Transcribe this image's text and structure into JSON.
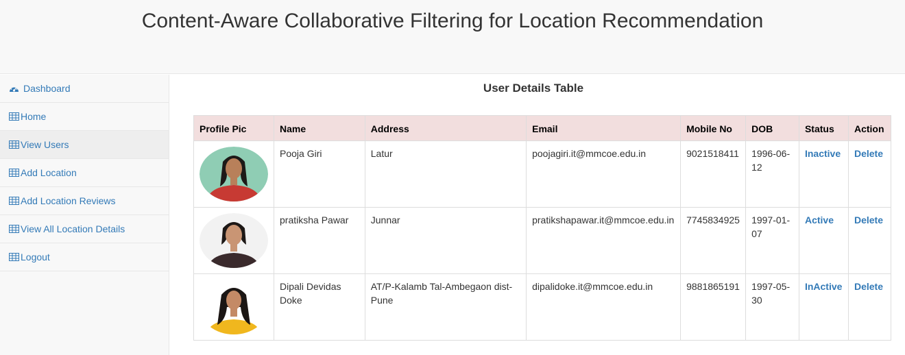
{
  "header": {
    "title": "Content-Aware Collaborative Filtering for Location Recommendation"
  },
  "sidebar": {
    "items": [
      {
        "label": "Dashboard",
        "icon": "dashboard-icon"
      },
      {
        "label": "Home",
        "icon": "table-icon"
      },
      {
        "label": "View Users",
        "icon": "table-icon"
      },
      {
        "label": "Add Location",
        "icon": "table-icon"
      },
      {
        "label": "Add Location Reviews",
        "icon": "table-icon"
      },
      {
        "label": "View All Location Details",
        "icon": "table-icon"
      },
      {
        "label": "Logout",
        "icon": "table-icon"
      }
    ],
    "active_index": 2
  },
  "main": {
    "title": "User Details Table",
    "columns": [
      "Profile Pic",
      "Name",
      "Address",
      "Email",
      "Mobile No",
      "DOB",
      "Status",
      "Action"
    ],
    "rows": [
      {
        "name": "Pooja Giri",
        "address": "Latur",
        "email": "poojagiri.it@mmcoe.edu.in",
        "mobile": "9021518411",
        "dob": "1996-06-12",
        "status": "Inactive",
        "action": "Delete"
      },
      {
        "name": "pratiksha Pawar",
        "address": "Junnar",
        "email": "pratikshapawar.it@mmcoe.edu.in",
        "mobile": "7745834925",
        "dob": "1997-01-07",
        "status": "Active",
        "action": "Delete"
      },
      {
        "name": "Dipali Devidas Doke",
        "address": "AT/P-Kalamb Tal-Ambegaon dist-Pune",
        "email": "dipalidoke.it@mmcoe.edu.in",
        "mobile": "9881865191",
        "dob": "1997-05-30",
        "status": "InActive",
        "action": "Delete"
      }
    ]
  },
  "colors": {
    "link": "#337ab7",
    "header_row": "#f2dede",
    "sidebar_bg": "#f8f8f8"
  }
}
